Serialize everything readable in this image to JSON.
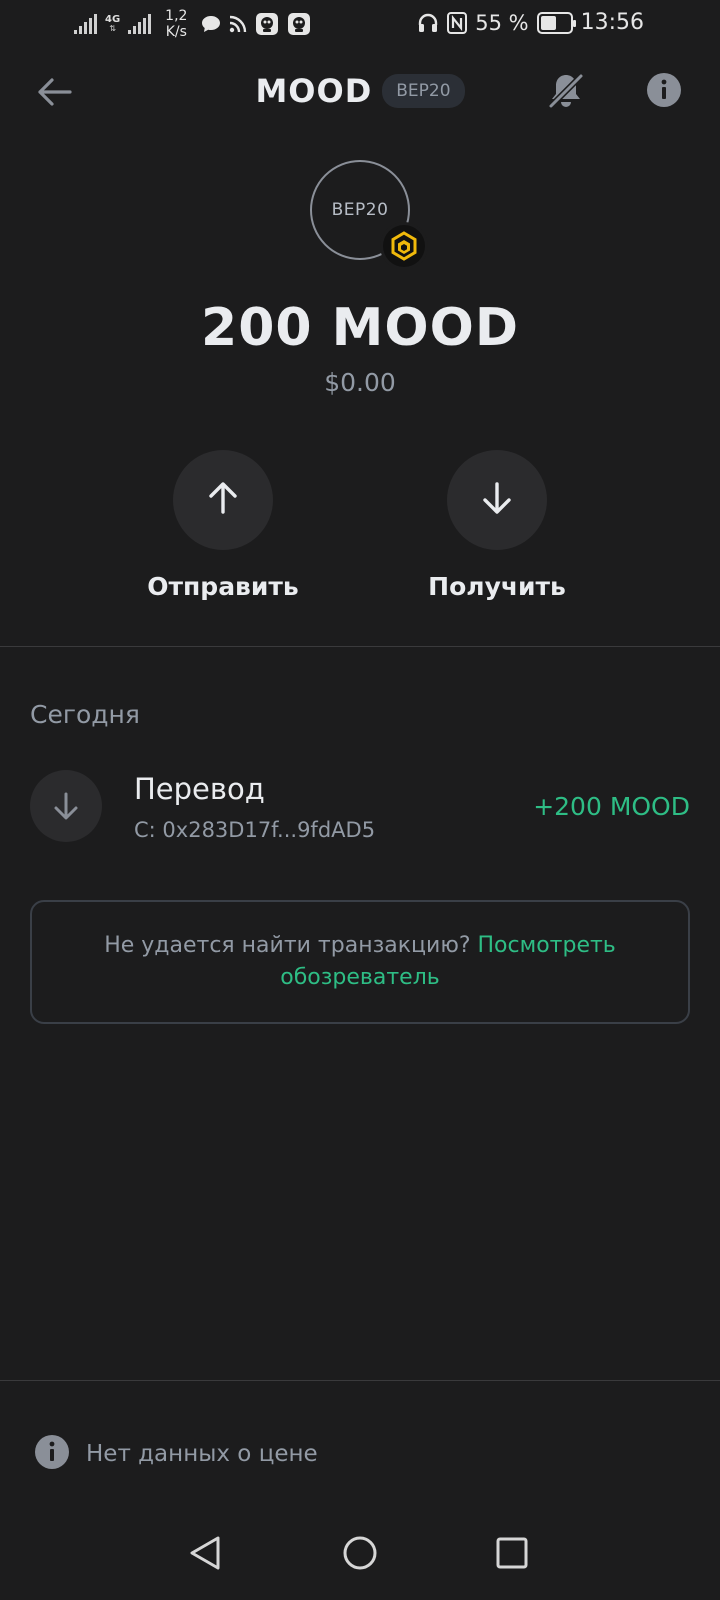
{
  "status_bar": {
    "network": "4G",
    "speed_value": "1,2",
    "speed_unit": "K/s",
    "battery_percent": "55 %",
    "battery_level": 0.55,
    "time": "13:56"
  },
  "header": {
    "title": "MOOD",
    "chain_badge": "BEP20"
  },
  "token": {
    "logo_text": "BEP20",
    "balance": "200 MOOD",
    "fiat": "$0.00"
  },
  "actions": {
    "send_label": "Отправить",
    "receive_label": "Получить"
  },
  "history": {
    "date_header": "Сегодня",
    "transactions": [
      {
        "type": "Перевод",
        "from": "С: 0x283D17f...9fdAD5",
        "amount": "+200 MOOD"
      }
    ],
    "explorer_prompt": "Не удается найти транзакцию?",
    "explorer_link": "Посмотреть обозреватель"
  },
  "footer": {
    "price_note": "Нет данных о цене"
  },
  "colors": {
    "background": "#1c1c1d",
    "positive": "#2ebd85",
    "muted": "#929aa5",
    "bnb_yellow": "#f0b90b"
  }
}
